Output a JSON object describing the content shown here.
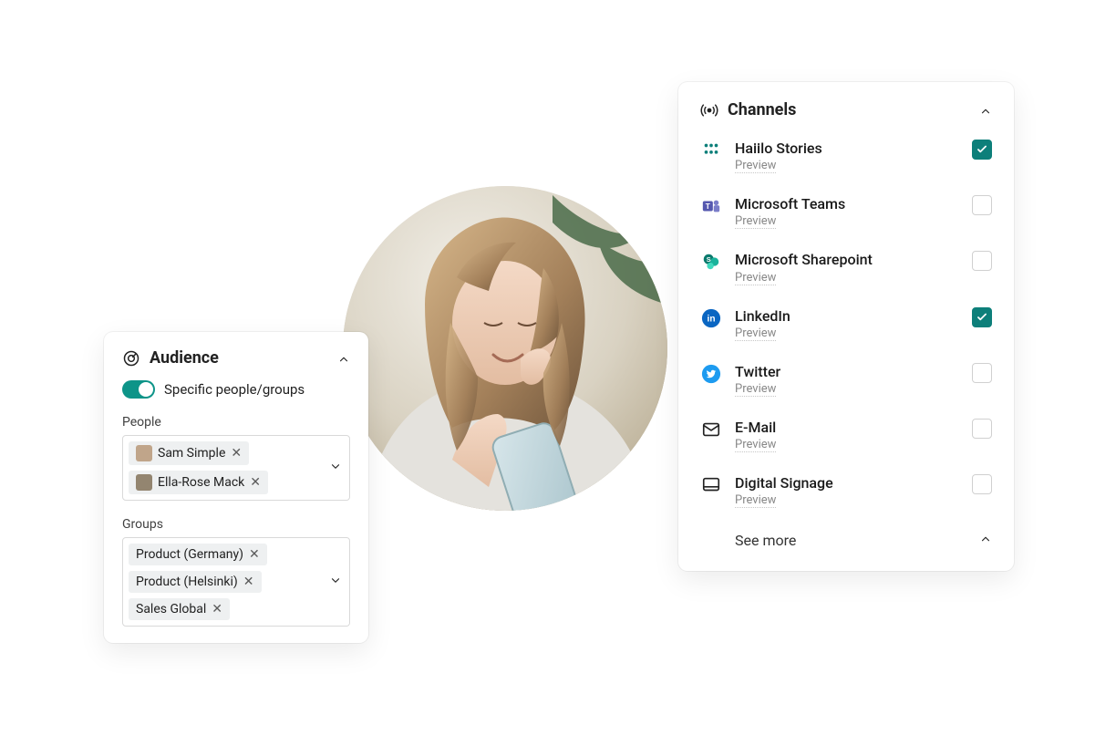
{
  "audience": {
    "title": "Audience",
    "toggle_label": "Specific people/groups",
    "toggle_on": true,
    "people_label": "People",
    "groups_label": "Groups",
    "people": [
      {
        "name": "Sam Simple",
        "avatar_color": "#c0a58a"
      },
      {
        "name": "Ella-Rose Mack",
        "avatar_color": "#938570"
      }
    ],
    "groups": [
      {
        "name": "Product (Germany)"
      },
      {
        "name": "Product (Helsinki)"
      },
      {
        "name": "Sales Global"
      }
    ]
  },
  "channels": {
    "title": "Channels",
    "preview_label": "Preview",
    "see_more": "See more",
    "items": [
      {
        "name": "Haiilo Stories",
        "icon": "haiilo",
        "checked": true
      },
      {
        "name": "Microsoft Teams",
        "icon": "msteams",
        "checked": false
      },
      {
        "name": "Microsoft Sharepoint",
        "icon": "sharepoint",
        "checked": false
      },
      {
        "name": "LinkedIn",
        "icon": "linkedin",
        "checked": true
      },
      {
        "name": "Twitter",
        "icon": "twitter",
        "checked": false
      },
      {
        "name": "E-Mail",
        "icon": "email",
        "checked": false
      },
      {
        "name": "Digital Signage",
        "icon": "signage",
        "checked": false
      }
    ]
  }
}
